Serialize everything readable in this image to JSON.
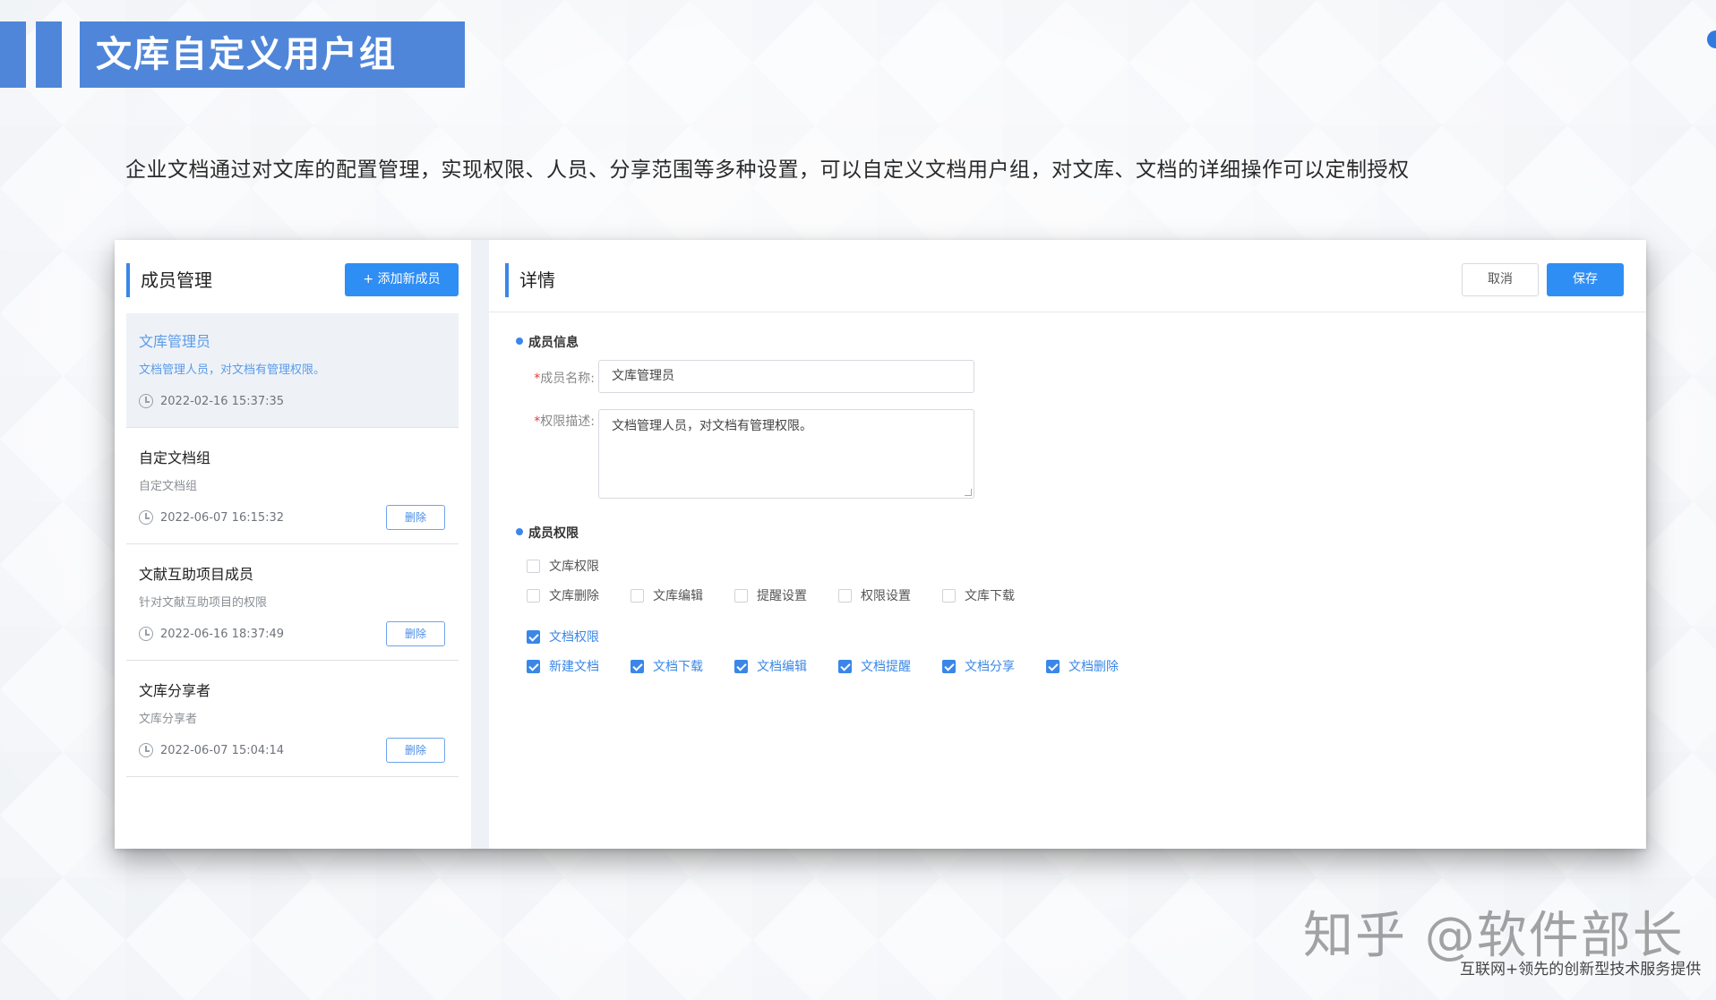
{
  "slide": {
    "title": "文库自定义用户组",
    "intro": "企业文档通过对文库的配置管理，实现权限、人员、分享范围等多种设置，可以自定义文档用户组，对文库、文档的详细操作可以定制授权"
  },
  "left": {
    "title": "成员管理",
    "add_button": "+ 添加新成员",
    "members": [
      {
        "name": "文库管理员",
        "desc": "文档管理人员，对文档有管理权限。",
        "time": "2022-02-16 15:37:35",
        "active": true
      },
      {
        "name": "自定文档组",
        "desc": "自定文档组",
        "time": "2022-06-07 16:15:32",
        "delete": "删除"
      },
      {
        "name": "文献互助项目成员",
        "desc": "针对文献互助项目的权限",
        "time": "2022-06-16 18:37:49",
        "delete": "删除"
      },
      {
        "name": "文库分享者",
        "desc": "文库分享者",
        "time": "2022-06-07 15:04:14",
        "delete": "删除"
      }
    ]
  },
  "right": {
    "title": "详情",
    "cancel": "取消",
    "save": "保存",
    "member_info_section": "成员信息",
    "name_label": "成员名称:",
    "name_value": "文库管理员",
    "desc_label": "权限描述:",
    "desc_value": "文档管理人员，对文档有管理权限。",
    "perm_section": "成员权限",
    "library_perm": {
      "label": "文库权限",
      "checked": false
    },
    "library_items": [
      {
        "label": "文库删除",
        "checked": false
      },
      {
        "label": "文库编辑",
        "checked": false
      },
      {
        "label": "提醒设置",
        "checked": false
      },
      {
        "label": "权限设置",
        "checked": false
      },
      {
        "label": "文库下载",
        "checked": false
      }
    ],
    "doc_perm": {
      "label": "文档权限",
      "checked": true
    },
    "doc_items": [
      {
        "label": "新建文档",
        "checked": true
      },
      {
        "label": "文档下载",
        "checked": true
      },
      {
        "label": "文档编辑",
        "checked": true
      },
      {
        "label": "文档提醒",
        "checked": true
      },
      {
        "label": "文档分享",
        "checked": true
      },
      {
        "label": "文档删除",
        "checked": true
      }
    ]
  },
  "watermark": {
    "main": "知乎 @软件部长",
    "sub": "互联网+领先的创新型技术服务提供"
  },
  "colors": {
    "accent": "#3a87e8",
    "header": "#4f86d9"
  }
}
